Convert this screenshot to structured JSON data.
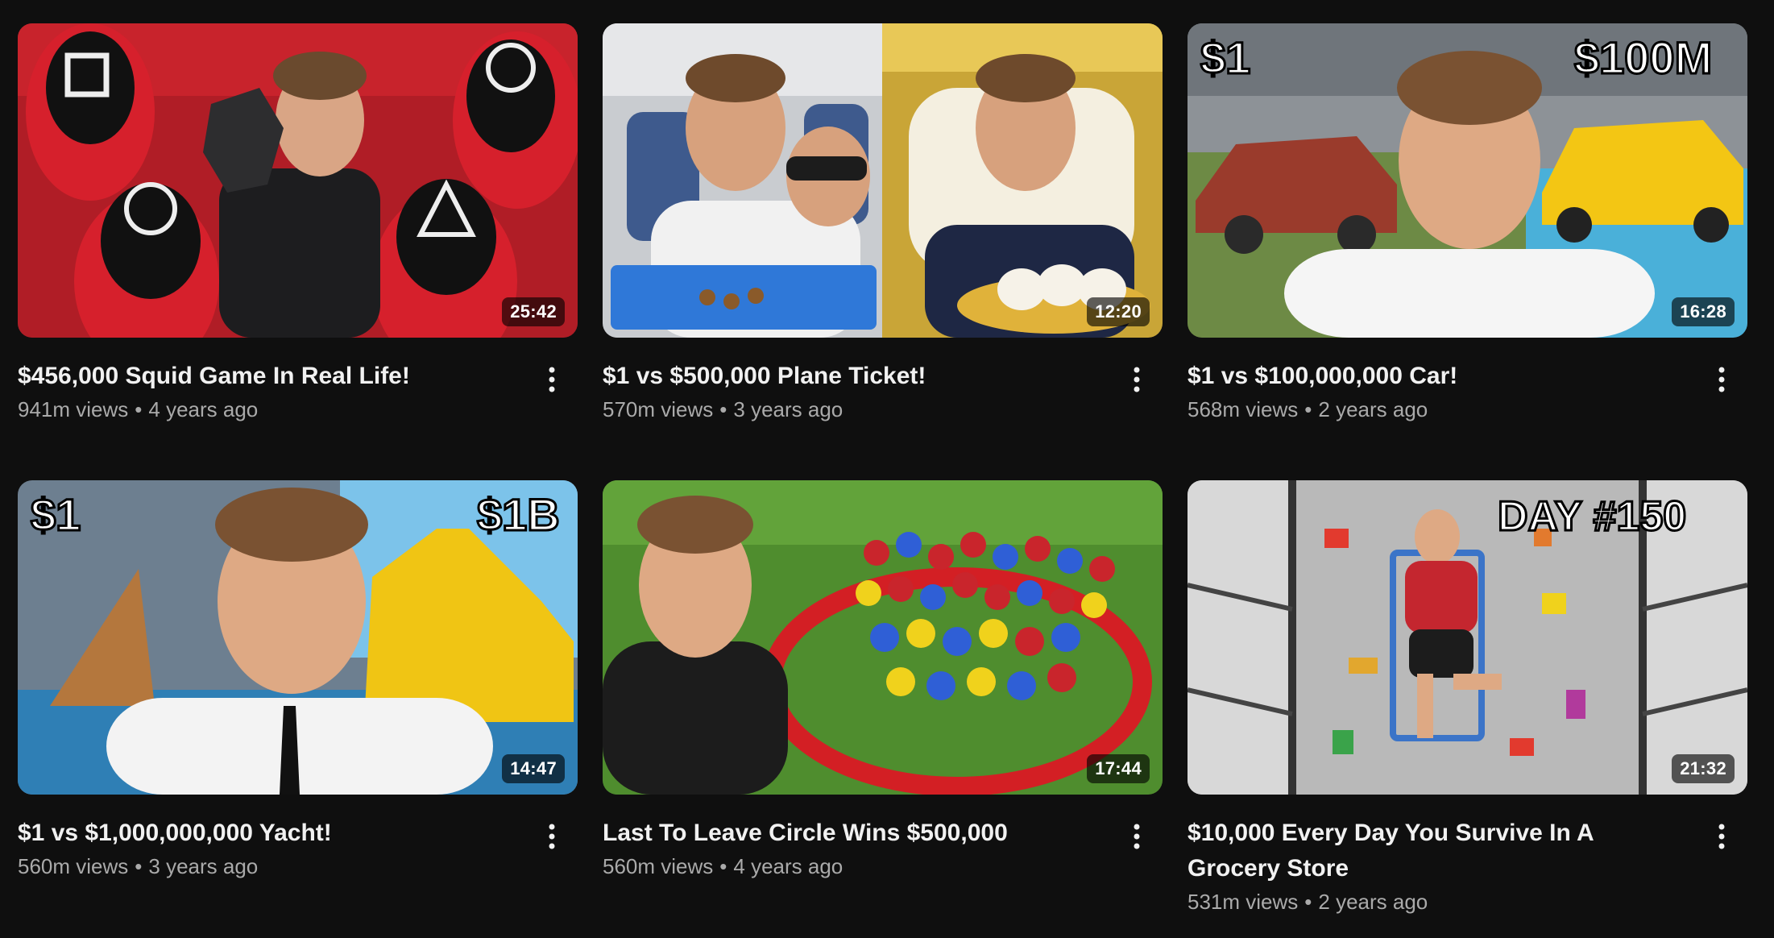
{
  "videos": [
    {
      "title": "$456,000 Squid Game In Real Life!",
      "views": "941m views",
      "age": "4 years ago",
      "duration": "25:42",
      "overlay_left": "",
      "overlay_right": ""
    },
    {
      "title": "$1 vs $500,000 Plane Ticket!",
      "views": "570m views",
      "age": "3 years ago",
      "duration": "12:20",
      "overlay_left": "",
      "overlay_right": ""
    },
    {
      "title": "$1 vs $100,000,000 Car!",
      "views": "568m views",
      "age": "2 years ago",
      "duration": "16:28",
      "overlay_left": "$1",
      "overlay_right": "$100M"
    },
    {
      "title": "$1 vs $1,000,000,000 Yacht!",
      "views": "560m views",
      "age": "3 years ago",
      "duration": "14:47",
      "overlay_left": "$1",
      "overlay_right": "$1B"
    },
    {
      "title": "Last To Leave Circle Wins $500,000",
      "views": "560m views",
      "age": "4 years ago",
      "duration": "17:44",
      "overlay_left": "",
      "overlay_right": ""
    },
    {
      "title": "$10,000 Every Day You Survive In A Grocery Store",
      "views": "531m views",
      "age": "2 years ago",
      "duration": "21:32",
      "overlay_left": "",
      "overlay_right": "DAY #150"
    }
  ],
  "separator": "•",
  "icons": {
    "more": "more-vert-icon"
  }
}
